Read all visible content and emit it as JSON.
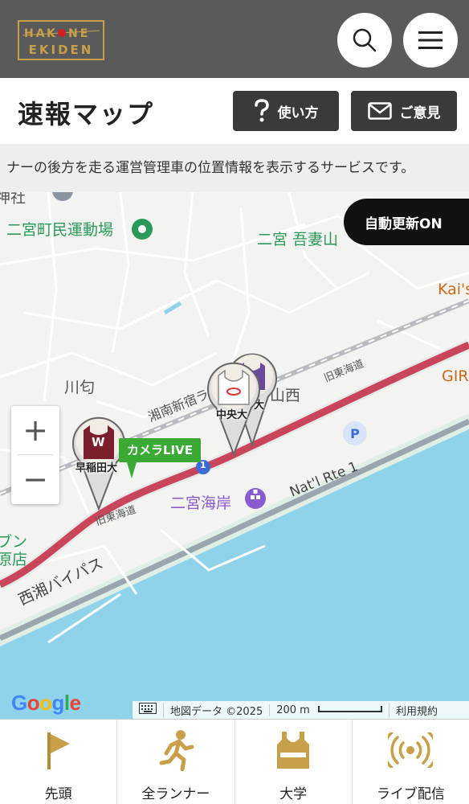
{
  "header": {
    "logo_top": "HAKONE",
    "logo_bottom": "EKIDEN",
    "search_icon": "search-icon",
    "menu_icon": "hamburger-menu-icon"
  },
  "titlebar": {
    "title": "速報マップ",
    "howto_label": "使い方",
    "opinion_label": "ご意見"
  },
  "ticker": {
    "text": "ナーの後方を走る運営管理車の位置情報を表示するサービスです。"
  },
  "map": {
    "auto_update_label": "自動更新ON",
    "camera_live_label": "カメラLIVE",
    "zoom_in": "+",
    "zoom_out": "−",
    "places": {
      "ninomiya_stadium": "二宮町民運動場",
      "ninomiya_azuma": "二宮 吾妻山",
      "kais": "Kai's",
      "gir": "GIR",
      "kawawa": "川匂",
      "yamanishi": "山西",
      "ninomiya_coast": "二宮海岸",
      "nishisho_bypass": "西湘バイパス",
      "shonan_shinjuku": "湘南新宿ラ",
      "kyu_tokaido_1": "旧東海道",
      "kyu_tokaido_2": "旧東海道",
      "natl_rte": "Nat'l Rte 1",
      "route_badge": "1",
      "partial_shrine": "神社",
      "partial_left": "ブン",
      "partial_left2": "原店"
    },
    "runners": [
      {
        "name": "早稲田大",
        "initial": "W",
        "color": "#7a1f2b"
      },
      {
        "name": "中央大",
        "color": "#d33"
      },
      {
        "name": "大",
        "color": "#6a4a9a"
      }
    ],
    "footer": {
      "keyboard_icon": "keyboard-icon",
      "map_data": "地図データ ©2025",
      "scale": "200 m",
      "terms": "利用規約"
    },
    "google": "Google"
  },
  "bottom_nav": [
    {
      "label": "先頭",
      "icon": "flag-icon"
    },
    {
      "label": "全ランナー",
      "icon": "runner-icon"
    },
    {
      "label": "大学",
      "icon": "jersey-icon"
    },
    {
      "label": "ライブ配信",
      "icon": "broadcast-icon"
    }
  ],
  "colors": {
    "header_bg": "#5a5a5a",
    "gold": "#c8a04a",
    "route_red": "#c9465a",
    "sea": "#8fd3ea",
    "park_green": "#2a9a5a",
    "poi_purple": "#8a5ad0",
    "camera_green": "#3aaa35"
  }
}
